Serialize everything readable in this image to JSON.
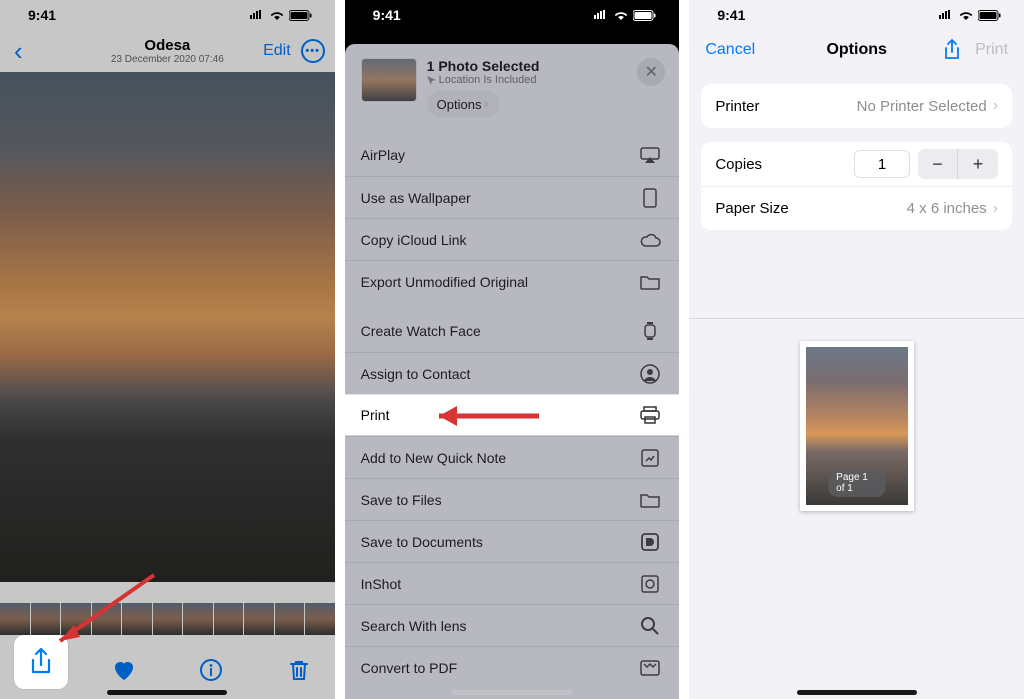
{
  "status_time": "9:41",
  "screen1": {
    "photo_title": "Odesa",
    "photo_subtitle": "23 December 2020  07:46",
    "edit_label": "Edit"
  },
  "screen2": {
    "header_title": "1 Photo Selected",
    "header_subtitle": "Location Is Included",
    "options_label": "Options",
    "actions": {
      "airplay": "AirPlay",
      "wallpaper": "Use as Wallpaper",
      "icloud": "Copy iCloud Link",
      "export": "Export Unmodified Original",
      "watchface": "Create Watch Face",
      "assign": "Assign to Contact",
      "print": "Print",
      "quicknote": "Add to New Quick Note",
      "save_files": "Save to Files",
      "save_docs": "Save to Documents",
      "inshot": "InShot",
      "lens": "Search With lens",
      "pdf": "Convert to PDF"
    }
  },
  "screen3": {
    "cancel_label": "Cancel",
    "title": "Options",
    "print_label": "Print",
    "printer_label": "Printer",
    "printer_value": "No Printer Selected",
    "copies_label": "Copies",
    "copies_value": "1",
    "paper_label": "Paper Size",
    "paper_value": "4 x 6 inches",
    "page_indicator": "Page 1 of 1"
  }
}
